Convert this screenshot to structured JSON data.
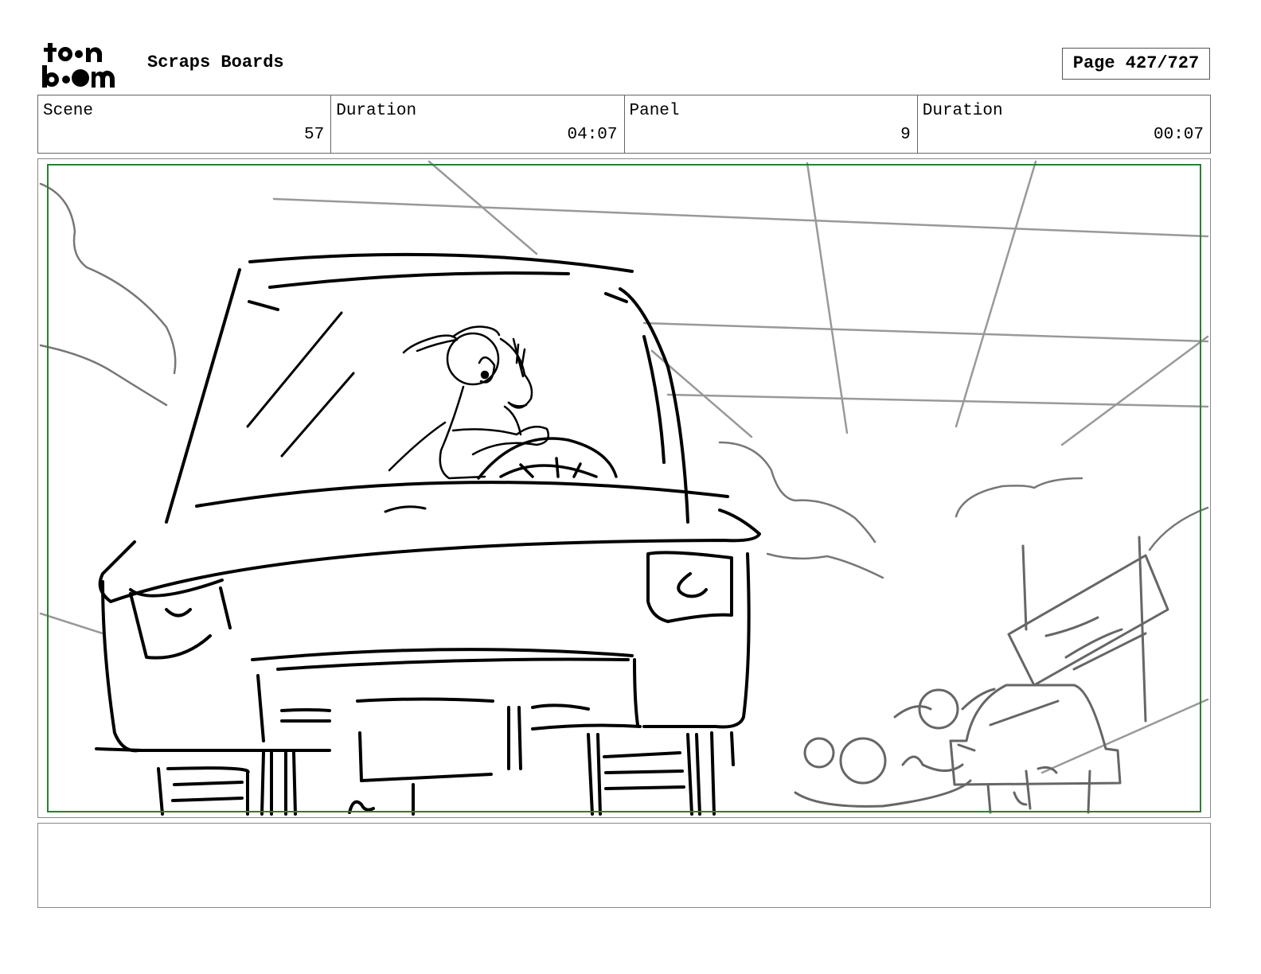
{
  "header": {
    "logo_line1": "to●n",
    "logo_line2": "b●●m",
    "project_title": "Scraps Boards",
    "page_label": "Page 427/727"
  },
  "info": [
    {
      "label": "Scene",
      "value": "57"
    },
    {
      "label": "Duration",
      "value": "04:07"
    },
    {
      "label": "Panel",
      "value": "9"
    },
    {
      "label": "Duration",
      "value": "00:07"
    }
  ],
  "panel": {
    "image_description_icon": "storyboard-sketch-icon",
    "safe_frame_color": "#2e7d32"
  },
  "dialogue": {
    "text": ""
  }
}
